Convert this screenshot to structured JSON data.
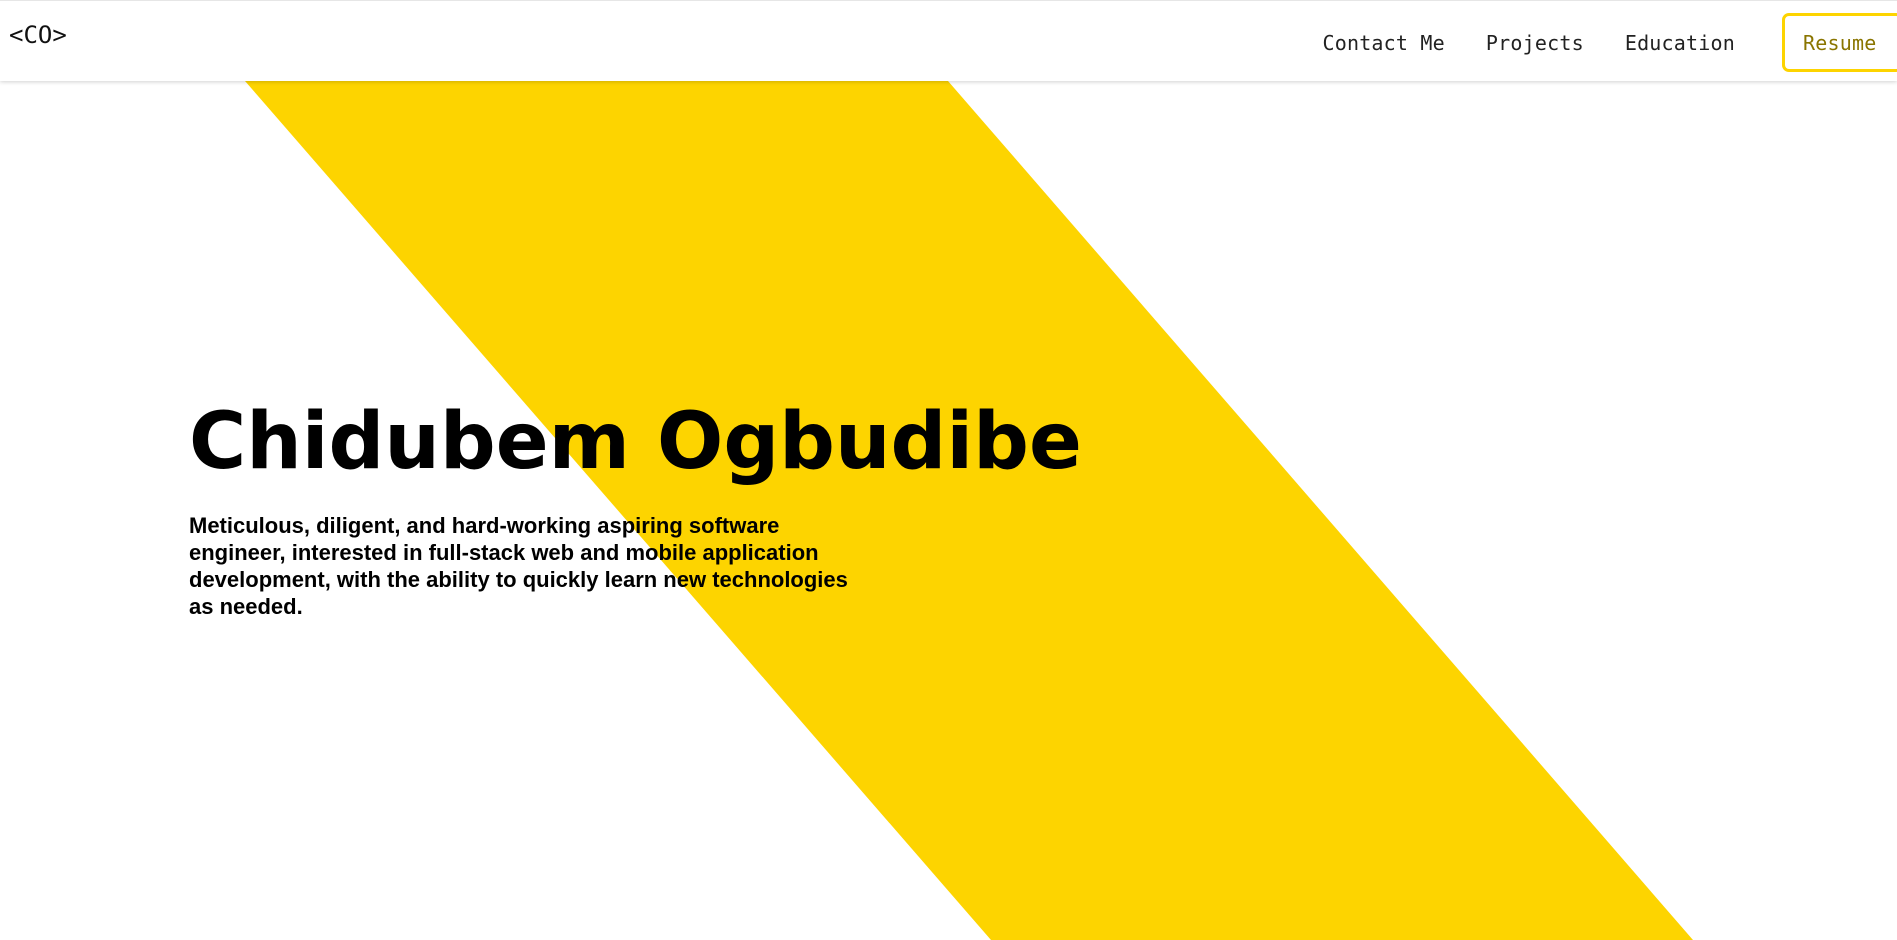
{
  "header": {
    "logo_text": "<CO>",
    "nav_links": [
      {
        "label": "Contact Me"
      },
      {
        "label": "Projects"
      },
      {
        "label": "Education"
      }
    ],
    "resume_button_label": "Resume"
  },
  "hero": {
    "name": "Chidubem Ogbudibe",
    "tagline": "Meticulous, diligent, and hard-working aspiring software engineer, interested in full-stack web and mobile application development, with the ability to quickly learn new technologies as needed."
  },
  "colors": {
    "accent_yellow": "#fdd400",
    "resume_text": "#8a7500",
    "background": "#ffffff",
    "text": "#000000"
  }
}
